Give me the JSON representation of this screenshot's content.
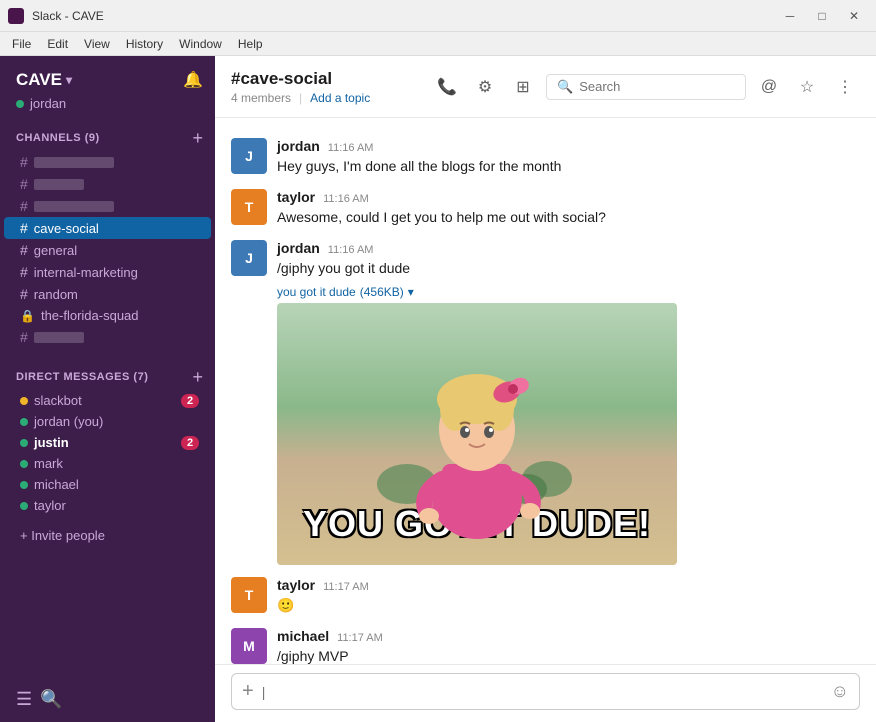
{
  "titlebar": {
    "title": "Slack - CAVE",
    "controls": {
      "minimize": "─",
      "maximize": "□",
      "close": "✕"
    }
  },
  "menubar": {
    "items": [
      "File",
      "Edit",
      "View",
      "History",
      "Window",
      "Help"
    ]
  },
  "sidebar": {
    "workspace": "CAVE",
    "chevron": "▾",
    "user": "jordan",
    "channels_section": "CHANNELS",
    "channels_count": "(9)",
    "channels": [
      {
        "name": "",
        "blurred": true,
        "active": false
      },
      {
        "name": "",
        "blurred": true,
        "active": false
      },
      {
        "name": "",
        "blurred": true,
        "active": false
      },
      {
        "name": "cave-social",
        "blurred": false,
        "active": true
      },
      {
        "name": "general",
        "blurred": false,
        "active": false
      },
      {
        "name": "internal-marketing",
        "blurred": false,
        "active": false
      },
      {
        "name": "random",
        "blurred": false,
        "active": false
      },
      {
        "name": "the-florida-squad",
        "blurred": false,
        "active": false,
        "locked": true
      },
      {
        "name": "",
        "blurred": true,
        "active": false
      }
    ],
    "dm_section": "DIRECT MESSAGES",
    "dm_count": "(7)",
    "dms": [
      {
        "name": "slackbot",
        "status": "yellow",
        "badge": 2,
        "bold": false
      },
      {
        "name": "jordan (you)",
        "status": "green",
        "badge": 0,
        "bold": false
      },
      {
        "name": "justin",
        "status": "green",
        "badge": 2,
        "bold": true
      },
      {
        "name": "mark",
        "status": "green",
        "badge": 0,
        "bold": false
      },
      {
        "name": "michael",
        "status": "green",
        "badge": 0,
        "bold": false
      },
      {
        "name": "taylor",
        "status": "green",
        "badge": 0,
        "bold": false
      }
    ],
    "invite_label": "+ Invite people"
  },
  "chat": {
    "channel_name": "#cave-social",
    "members": "4 members",
    "add_topic": "Add a topic",
    "search_placeholder": "Search",
    "messages": [
      {
        "author": "jordan",
        "avatar_initials": "J",
        "avatar_class": "jordan",
        "time": "11:16 AM",
        "text": "Hey guys, I'm done all the blogs for the month",
        "has_giphy": false
      },
      {
        "author": "taylor",
        "avatar_initials": "T",
        "avatar_class": "taylor",
        "time": "11:16 AM",
        "text": "Awesome, could I get you to help me out with social?",
        "has_giphy": false
      },
      {
        "author": "jordan",
        "avatar_initials": "J",
        "avatar_class": "jordan",
        "time": "11:16 AM",
        "text": "/giphy you got it dude",
        "has_giphy": true,
        "giphy_label": "you got it dude",
        "giphy_size": "456KB",
        "giphy_text": "YOU GOT IT DUDE!"
      },
      {
        "author": "taylor",
        "avatar_initials": "T",
        "avatar_class": "taylor",
        "time": "11:17 AM",
        "text": "🙂",
        "has_giphy": false
      },
      {
        "author": "michael",
        "avatar_initials": "M",
        "avatar_class": "michael",
        "time": "11:17 AM",
        "text": "/giphy MVP",
        "has_giphy": false
      }
    ],
    "input_placeholder": "|"
  }
}
